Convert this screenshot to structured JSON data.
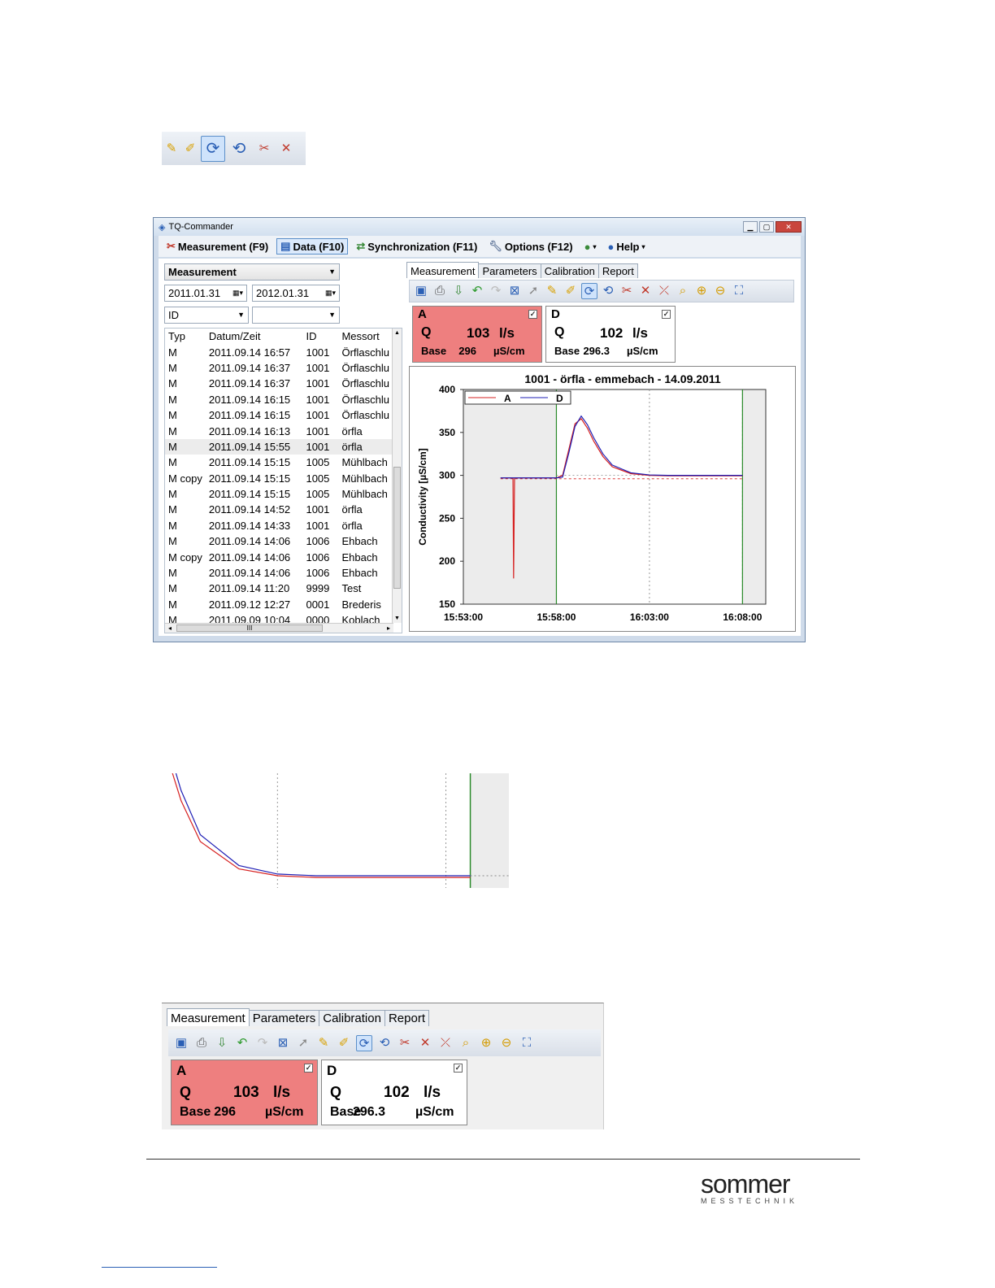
{
  "colors": {
    "series_a": "#d62020",
    "series_d": "#1f1fb5",
    "marker": "#2a8a2a",
    "card_a_bg": "#ee7f7f"
  },
  "small_toolbar": {
    "icons": [
      "pen-icon",
      "marker-icon",
      "sync-icon",
      "sync-end-icon",
      "remove-outlier-icon",
      "delete-marker-icon"
    ]
  },
  "window": {
    "title": "TQ-Commander",
    "menu": {
      "measurement": "Measurement (F9)",
      "data": "Data (F10)",
      "sync": "Synchronization (F11)",
      "options": "Options (F12)",
      "help": "Help"
    },
    "filter": {
      "type_select": "Measurement",
      "date_from": "2011.01.31",
      "date_to": "2012.01.31",
      "field_select": "ID",
      "field_value": ""
    },
    "list": {
      "columns": [
        "Typ",
        "Datum/Zeit",
        "ID",
        "Messort"
      ],
      "rows": [
        [
          "M",
          "2011.09.14 16:57",
          "1001",
          "Örflaschlu"
        ],
        [
          "M",
          "2011.09.14 16:37",
          "1001",
          "Örflaschlu"
        ],
        [
          "M",
          "2011.09.14 16:37",
          "1001",
          "Örflaschlu"
        ],
        [
          "M",
          "2011.09.14 16:15",
          "1001",
          "Örflaschlu"
        ],
        [
          "M",
          "2011.09.14 16:15",
          "1001",
          "Örflaschlu"
        ],
        [
          "M",
          "2011.09.14 16:13",
          "1001",
          "örfla"
        ],
        [
          "M",
          "2011.09.14 15:55",
          "1001",
          "örfla"
        ],
        [
          "M",
          "2011.09.14 15:15",
          "1005",
          "Mühlbach"
        ],
        [
          "M copy",
          "2011.09.14 15:15",
          "1005",
          "Mühlbach"
        ],
        [
          "M",
          "2011.09.14 15:15",
          "1005",
          "Mühlbach"
        ],
        [
          "M",
          "2011.09.14 14:52",
          "1001",
          "örfla"
        ],
        [
          "M",
          "2011.09.14 14:33",
          "1001",
          "örfla"
        ],
        [
          "M",
          "2011.09.14 14:06",
          "1006",
          "Ehbach"
        ],
        [
          "M copy",
          "2011.09.14 14:06",
          "1006",
          "Ehbach"
        ],
        [
          "M",
          "2011.09.14 14:06",
          "1006",
          "Ehbach"
        ],
        [
          "M",
          "2011.09.14 11:20",
          "9999",
          "Test"
        ],
        [
          "M",
          "2011.09.12 12:27",
          "0001",
          "Brederis"
        ],
        [
          "M",
          "2011.09.09 10:04",
          "0000",
          "Koblach"
        ]
      ],
      "selected_index": 6,
      "scroll_mark": "III"
    },
    "tabs": [
      "Measurement",
      "Parameters",
      "Calibration",
      "Report"
    ],
    "cards": [
      {
        "name": "A",
        "q_label": "Q",
        "q_value": "103",
        "q_unit": "l/s",
        "base_label": "Base",
        "base_value": "296",
        "base_unit": "µS/cm",
        "checked": "✓"
      },
      {
        "name": "D",
        "q_label": "Q",
        "q_value": "102",
        "q_unit": "l/s",
        "base_label": "Base",
        "base_value": "296.3",
        "base_unit": "µS/cm",
        "checked": "✓"
      }
    ]
  },
  "chart_data": {
    "type": "line",
    "title": "1001 - örfla - emmebach - 14.09.2011",
    "ylabel": "Conductivity [µS/cm]",
    "xlabel": "",
    "ylim": [
      150,
      400
    ],
    "yticks": [
      150,
      200,
      250,
      300,
      350,
      400
    ],
    "xticks": [
      "15:53:00",
      "15:58:00",
      "16:03:00",
      "16:08:00"
    ],
    "xlim_seconds_from_1553": [
      0,
      975
    ],
    "legend": {
      "placement": "top-left",
      "entries": [
        "A",
        "D"
      ]
    },
    "markers_x": [
      "15:58:00",
      "16:08:00"
    ],
    "base_lines": {
      "A": 296,
      "D": 300
    },
    "series": [
      {
        "name": "A",
        "x": [
          "15:55:00",
          "15:55:40",
          "15:55:42",
          "15:55:45",
          "15:55:50",
          "15:58:00",
          "15:58:20",
          "15:58:40",
          "15:59:00",
          "15:59:20",
          "15:59:40",
          "16:00:00",
          "16:00:30",
          "16:01:00",
          "16:02:00",
          "16:03:00",
          "16:04:00",
          "16:05:00",
          "16:06:00",
          "16:08:00"
        ],
        "y": [
          297,
          297,
          180,
          297,
          297,
          297,
          300,
          330,
          360,
          366,
          355,
          340,
          322,
          310,
          302,
          300,
          299.5,
          299.5,
          299.5,
          299.5
        ]
      },
      {
        "name": "D",
        "x": [
          "15:55:00",
          "15:58:00",
          "15:58:20",
          "15:58:40",
          "15:59:00",
          "15:59:20",
          "15:59:40",
          "16:00:00",
          "16:00:30",
          "16:01:00",
          "16:02:00",
          "16:03:00",
          "16:04:00",
          "16:05:00",
          "16:06:00",
          "16:08:00"
        ],
        "y": [
          297,
          297,
          298,
          326,
          357,
          369,
          359,
          344,
          325,
          312,
          303,
          300.5,
          300,
          300,
          300,
          300
        ]
      }
    ]
  },
  "zoom_detail": {
    "description_free": true
  },
  "toolbar_large": {
    "tabs": [
      "Measurement",
      "Parameters",
      "Calibration",
      "Report"
    ],
    "cards": [
      {
        "name": "A",
        "q_label": "Q",
        "q_value": "103",
        "q_unit": "l/s",
        "base_label": "Base",
        "base_value": "296",
        "base_unit": "µS/cm",
        "checked": "✓"
      },
      {
        "name": "D",
        "q_label": "Q",
        "q_value": "102",
        "q_unit": "l/s",
        "base_label": "Base",
        "base_value": "296.3",
        "base_unit": "µS/cm",
        "checked": "✓"
      }
    ]
  },
  "logo": {
    "text": "sommer",
    "subtext": "MESSTECHNIK"
  }
}
